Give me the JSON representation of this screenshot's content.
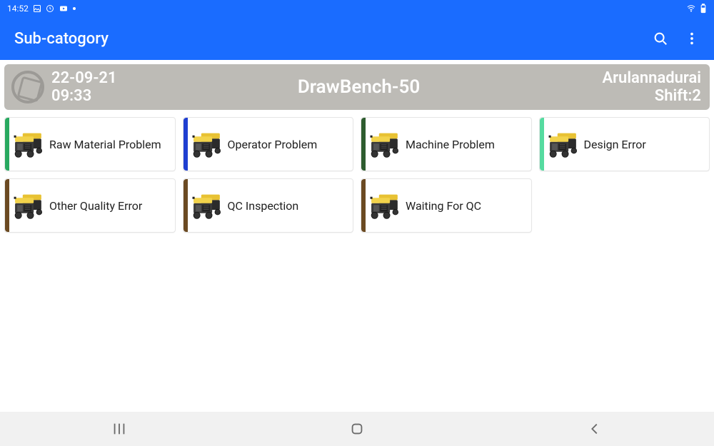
{
  "status": {
    "time": "14:52",
    "icons": [
      "image-icon",
      "clock-icon",
      "youtube-icon",
      "dot-icon"
    ],
    "right": [
      "wifi-icon",
      "battery-icon"
    ]
  },
  "appbar": {
    "title": "Sub-catogory"
  },
  "banner": {
    "date": "22-09-21",
    "time": "09:33",
    "center": "DrawBench-50",
    "user": "Arulannadurai",
    "shift": "Shift:2"
  },
  "accent_colors": {
    "green": "#28a960",
    "blue": "#1f3fd1",
    "darkgreen": "#2e5c2f",
    "mint": "#55dba0",
    "brown": "#6b4a22"
  },
  "cards": [
    {
      "label": "Raw Material Problem",
      "accent": "green"
    },
    {
      "label": "Operator Problem",
      "accent": "blue"
    },
    {
      "label": "Machine Problem",
      "accent": "darkgreen"
    },
    {
      "label": "Design Error",
      "accent": "mint"
    },
    {
      "label": "Other Quality Error",
      "accent": "brown"
    },
    {
      "label": "QC Inspection",
      "accent": "brown"
    },
    {
      "label": "Waiting For QC",
      "accent": "brown"
    }
  ]
}
